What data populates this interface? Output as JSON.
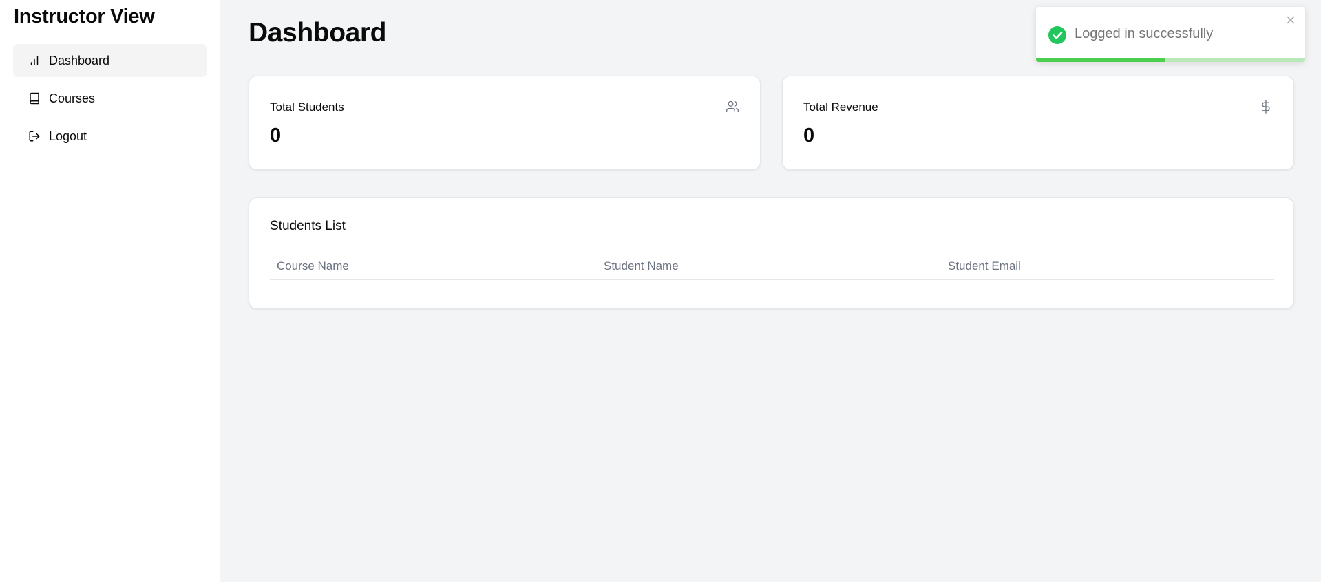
{
  "sidebar": {
    "title": "Instructor View",
    "items": [
      {
        "label": "Dashboard",
        "icon": "bar-chart-icon",
        "active": true
      },
      {
        "label": "Courses",
        "icon": "book-icon",
        "active": false
      },
      {
        "label": "Logout",
        "icon": "logout-icon",
        "active": false
      }
    ]
  },
  "main": {
    "title": "Dashboard",
    "stats": [
      {
        "label": "Total Students",
        "value": "0",
        "icon": "users-icon"
      },
      {
        "label": "Total Revenue",
        "value": "0",
        "icon": "dollar-icon"
      }
    ],
    "students_list": {
      "title": "Students List",
      "columns": [
        "Course Name",
        "Student Name",
        "Student Email"
      ],
      "rows": []
    }
  },
  "toast": {
    "message": "Logged in successfully",
    "status_color": "#22c55e",
    "progress": 0.48
  }
}
